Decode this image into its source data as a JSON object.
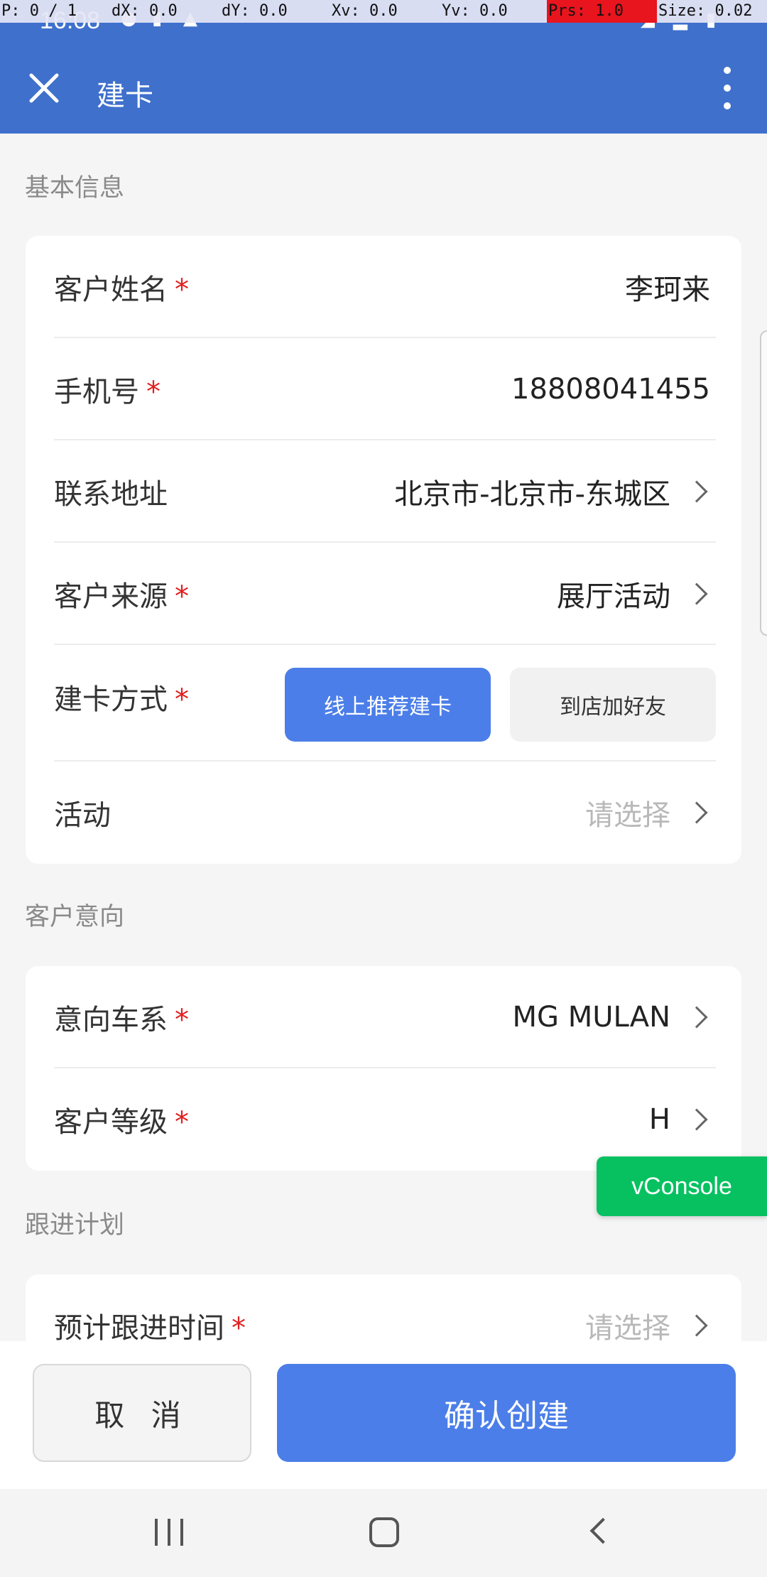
{
  "debug": {
    "p": "P: 0 / 1",
    "dx": "dX: 0.0",
    "dy": "dY: 0.0",
    "xv": "Xv: 0.0",
    "yv": "Yv: 0.0",
    "prs": "Prs: 1.0",
    "size": "Size: 0.02"
  },
  "status": {
    "time": "16:08"
  },
  "header": {
    "title": "建卡"
  },
  "sections": {
    "basic": "基本信息",
    "intent": "客户意向",
    "plan": "跟进计划"
  },
  "basic": {
    "name_label": "客户姓名",
    "name_value": "李珂来",
    "phone_label": "手机号",
    "phone_value": "18808041455",
    "address_label": "联系地址",
    "address_value": "北京市-北京市-东城区",
    "source_label": "客户来源",
    "source_value": "展厅活动",
    "method_label": "建卡方式",
    "method_options": [
      "线上推荐建卡",
      "到店加好友"
    ],
    "activity_label": "活动",
    "activity_placeholder": "请选择"
  },
  "intent": {
    "series_label": "意向车系",
    "series_value": "MG MULAN",
    "level_label": "客户等级",
    "level_value": "H"
  },
  "plan": {
    "time_label": "预计跟进时间",
    "time_placeholder": "请选择"
  },
  "required_mark": "*",
  "vconsole": "vConsole",
  "actions": {
    "cancel": "取 消",
    "confirm": "确认创建"
  },
  "colors": {
    "header": "#3f70cc",
    "primary": "#4b7ee8",
    "required": "#e02020",
    "vconsole": "#07c160"
  }
}
